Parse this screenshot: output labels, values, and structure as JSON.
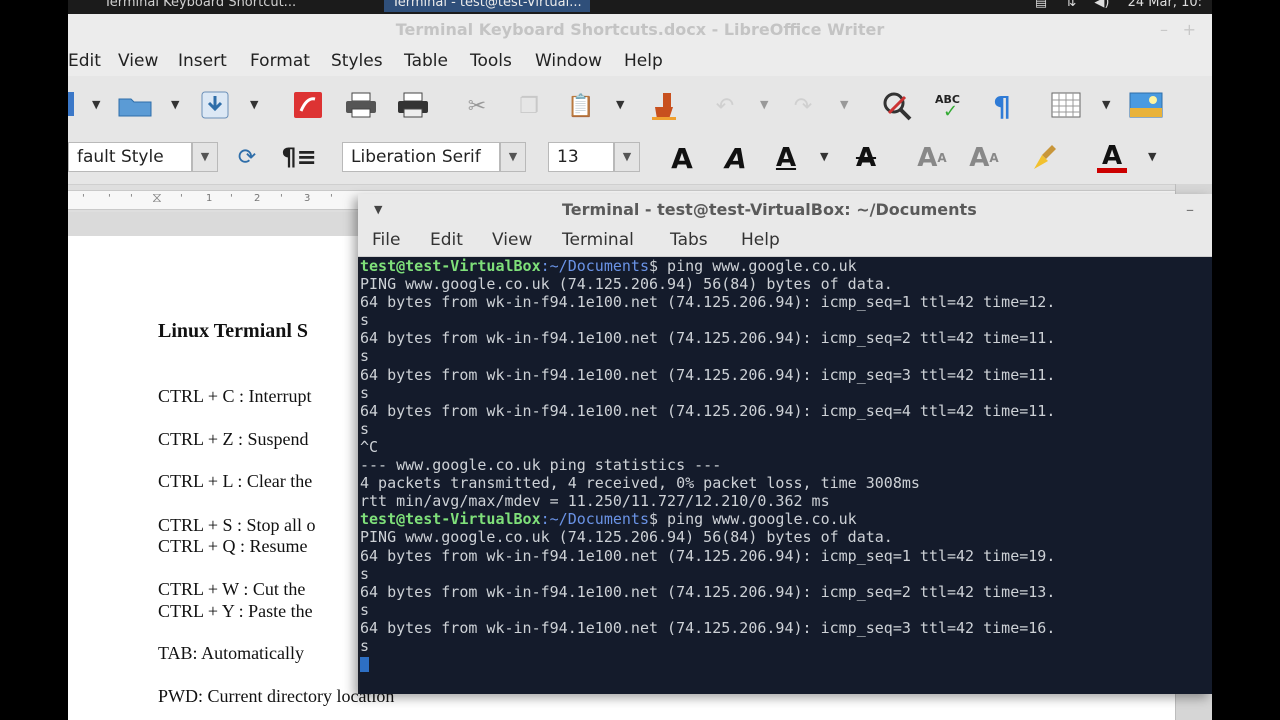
{
  "taskbar": {
    "tasks": [
      "Terminal Keyboard Shortcut...",
      "Terminal - test@test-Virtual..."
    ],
    "clock": "24 Mar, 10:"
  },
  "writer": {
    "title": "Terminal Keyboard Shortcuts.docx - LibreOffice Writer",
    "menu": [
      "Edit",
      "View",
      "Insert",
      "Format",
      "Styles",
      "Table",
      "Tools",
      "Window",
      "Help"
    ],
    "paragraph_style": "fault Style",
    "font_name": "Liberation Serif",
    "font_size": "13",
    "ruler_numbers": [
      "1",
      "2",
      "3"
    ],
    "document": {
      "title": "Linux Termianl S",
      "lines": [
        "CTRL + C : Interrupt",
        "CTRL + Z : Suspend",
        "CTRL + L : Clear the",
        "CTRL + S : Stop all o",
        "CTRL + Q : Resume",
        "CTRL + W : Cut the",
        "CTRL + Y : Paste the",
        "TAB:  Automatically",
        "PWD: Current directory location"
      ]
    }
  },
  "terminal": {
    "title": "Terminal - test@test-VirtualBox: ~/Documents",
    "menu": [
      "File",
      "Edit",
      "View",
      "Terminal",
      "Tabs",
      "Help"
    ],
    "prompt": {
      "user": "test@test-VirtualBox",
      "path": "~/Documents",
      "symbol": "$"
    },
    "lines": [
      {
        "user": "test@test-VirtualBox",
        "path": ":~/Documents",
        "cmd": "$ ping www.google.co.uk"
      },
      {
        "text": "PING www.google.co.uk (74.125.206.94) 56(84) bytes of data."
      },
      {
        "text": "64 bytes from wk-in-f94.1e100.net (74.125.206.94): icmp_seq=1 ttl=42 time=12."
      },
      {
        "text": "s"
      },
      {
        "text": "64 bytes from wk-in-f94.1e100.net (74.125.206.94): icmp_seq=2 ttl=42 time=11."
      },
      {
        "text": "s"
      },
      {
        "text": "64 bytes from wk-in-f94.1e100.net (74.125.206.94): icmp_seq=3 ttl=42 time=11."
      },
      {
        "text": "s"
      },
      {
        "text": "64 bytes from wk-in-f94.1e100.net (74.125.206.94): icmp_seq=4 ttl=42 time=11."
      },
      {
        "text": "s"
      },
      {
        "text": "^C"
      },
      {
        "text": "--- www.google.co.uk ping statistics ---"
      },
      {
        "text": "4 packets transmitted, 4 received, 0% packet loss, time 3008ms"
      },
      {
        "text": "rtt min/avg/max/mdev = 11.250/11.727/12.210/0.362 ms"
      },
      {
        "user": "test@test-VirtualBox",
        "path": ":~/Documents",
        "cmd": "$ ping www.google.co.uk"
      },
      {
        "text": "PING www.google.co.uk (74.125.206.94) 56(84) bytes of data."
      },
      {
        "text": "64 bytes from wk-in-f94.1e100.net (74.125.206.94): icmp_seq=1 ttl=42 time=19."
      },
      {
        "text": "s"
      },
      {
        "text": "64 bytes from wk-in-f94.1e100.net (74.125.206.94): icmp_seq=2 ttl=42 time=13."
      },
      {
        "text": "s"
      },
      {
        "text": "64 bytes from wk-in-f94.1e100.net (74.125.206.94): icmp_seq=3 ttl=42 time=16."
      },
      {
        "text": "s"
      },
      {
        "cursor": true
      }
    ]
  }
}
